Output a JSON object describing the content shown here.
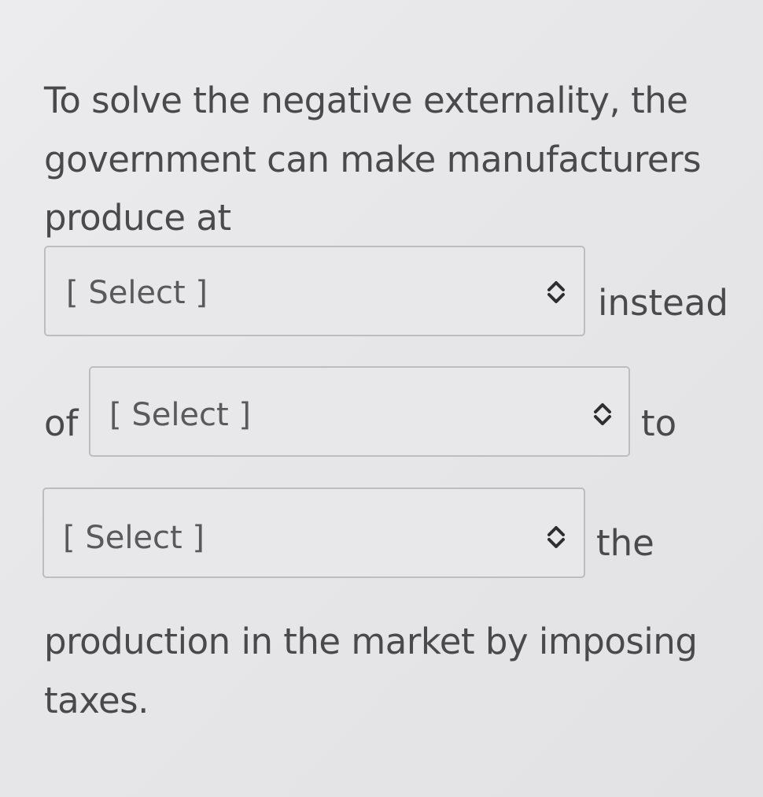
{
  "question": {
    "line1": "To solve the negative externality, the",
    "line2": "government can make manufacturers",
    "line3": "produce at",
    "after_select1": "instead",
    "before_select2": "of",
    "after_select2": "to",
    "after_select3": "the",
    "line_final1": "production in the market by imposing",
    "line_final2": "taxes."
  },
  "dropdowns": [
    {
      "value": "[ Select ]"
    },
    {
      "value": "[ Select ]"
    },
    {
      "value": "[ Select ]"
    }
  ],
  "icons": {
    "dropdown_chevron": "chevron-up-down-icon"
  }
}
